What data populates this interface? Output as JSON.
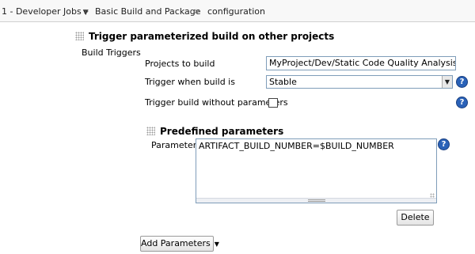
{
  "breadcrumb": {
    "items": [
      {
        "label": "1 - Developer Jobs"
      },
      {
        "label": "Basic Build and Package"
      },
      {
        "label": "configuration"
      }
    ]
  },
  "trigger_section": {
    "title": "Trigger parameterized build on other projects",
    "group_label": "Build Triggers",
    "projects_label": "Projects to build",
    "projects_value": "MyProject/Dev/Static Code Quality Analysis",
    "trigger_when_label": "Trigger when build is",
    "trigger_when_value": "Stable",
    "without_params_label": "Trigger build without parameters"
  },
  "predefined_section": {
    "title": "Predefined parameters",
    "parameters_label": "Parameters",
    "parameters_value": "ARTIFACT_BUILD_NUMBER=$BUILD_NUMBER",
    "delete_label": "Delete"
  },
  "add_parameters_label": "Add Parameters",
  "icons": {
    "help": "?",
    "dropdown": "▼",
    "separator": "»"
  }
}
